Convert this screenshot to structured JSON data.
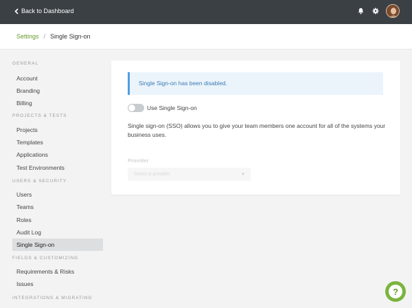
{
  "topbar": {
    "back_label": "Back to Dashboard",
    "icons": [
      "chevron-left-icon",
      "bell-icon",
      "gear-icon"
    ]
  },
  "breadcrumb": {
    "parent": "Settings",
    "separator": "/",
    "current": "Single Sign-on"
  },
  "sidebar": {
    "sections": [
      {
        "title": "GENERAL",
        "items": [
          "Account",
          "Branding",
          "Billing"
        ]
      },
      {
        "title": "PROJECTS & TESTS",
        "items": [
          "Projects",
          "Templates",
          "Applications",
          "Test Environments"
        ]
      },
      {
        "title": "USERS & SECURITY",
        "items": [
          "Users",
          "Teams",
          "Roles",
          "Audit Log",
          "Single Sign-on"
        ]
      },
      {
        "title": "FIELDS & CUSTOMIZING",
        "items": [
          "Requirements & Risks",
          "Issues"
        ]
      },
      {
        "title": "INTEGRATIONS & MIGRATING",
        "items": []
      }
    ],
    "active_item": "Single Sign-on"
  },
  "main": {
    "alert": "Single Sign-on has been disabled.",
    "toggle_label": "Use Single Sign-on",
    "toggle_on": false,
    "description": "Single sign-on (SSO) allows you to give your team members one account for all of the systems your business uses.",
    "provider_label": "Provider",
    "provider_placeholder": "Select a provider"
  },
  "colors": {
    "topbar": "#3b4045",
    "accent_green": "#6a9b2c",
    "alert_border": "#4d9fe0",
    "alert_bg": "#ebf4fb",
    "help_button": "#7bb43d"
  },
  "help_icon": "question-mark-icon"
}
